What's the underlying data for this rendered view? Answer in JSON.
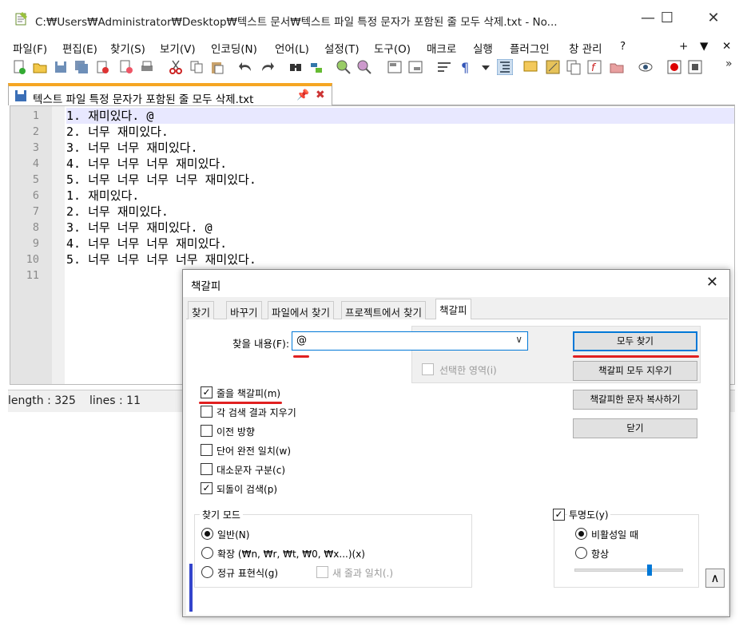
{
  "window": {
    "title": "C:₩Users₩Administrator₩Desktop₩텍스트 문서₩텍스트 파일 특정 문자가 포함된 줄 모두 삭제.txt - No...",
    "minimize": "—",
    "maximize": "☐",
    "close": "✕"
  },
  "menu": [
    "파일(F)",
    "편집(E)",
    "찾기(S)",
    "보기(V)",
    "인코딩(N)",
    "언어(L)",
    "설정(T)",
    "도구(O)",
    "매크로",
    "실행",
    "플러그인",
    "창 관리",
    "?"
  ],
  "menu_right": {
    "plus": "+",
    "down": "▼",
    "close": "✕"
  },
  "toolbar_overflow": "»",
  "tab": {
    "label": "텍스트 파일 특정 문자가 포함된 줄 모두 삭제.txt",
    "pin": "📌",
    "close": "✖"
  },
  "editor": {
    "lines": [
      {
        "n": "1",
        "text": "1. 재미있다. @"
      },
      {
        "n": "2",
        "text": "2. 너무 재미있다."
      },
      {
        "n": "3",
        "text": "3. 너무 너무 재미있다."
      },
      {
        "n": "4",
        "text": "4. 너무 너무 너무 재미있다."
      },
      {
        "n": "5",
        "text": "5. 너무 너무 너무 너무 재미있다."
      },
      {
        "n": "6",
        "text": "1. 재미있다."
      },
      {
        "n": "7",
        "text": "2. 너무 재미있다."
      },
      {
        "n": "8",
        "text": "3. 너무 너무 재미있다. @"
      },
      {
        "n": "9",
        "text": "4. 너무 너무 너무 재미있다."
      },
      {
        "n": "10",
        "text": "5. 너무 너무 너무 너무 재미있다."
      },
      {
        "n": "11",
        "text": ""
      }
    ]
  },
  "status": {
    "length": "length : 325",
    "lines": "lines : 11"
  },
  "dialog": {
    "title": "책갈피",
    "close": "✕",
    "tabs": [
      "찾기",
      "바꾸기",
      "파일에서 찾기",
      "프로젝트에서 찾기",
      "책갈피"
    ],
    "find_label": "찾을 내용(F):",
    "find_value": "@",
    "combo_arrow": "∨",
    "in_selection": "선택한 영역(i)",
    "buttons": {
      "find_all": "모두 찾기",
      "clear_all": "책갈피 모두 지우기",
      "copy_marked": "책갈피한 문자 복사하기",
      "close": "닫기"
    },
    "options": [
      {
        "label": "줄을 책갈피(m)",
        "checked": "✓"
      },
      {
        "label": "각 검색 결과 지우기",
        "checked": ""
      },
      {
        "label": "이전 방향",
        "checked": ""
      },
      {
        "label": "단어 완전 일치(w)",
        "checked": ""
      },
      {
        "label": "대소문자 구분(c)",
        "checked": ""
      },
      {
        "label": "되돌이 검색(p)",
        "checked": "✓"
      }
    ],
    "search_mode": {
      "title": "찾기 모드",
      "normal": "일반(N)",
      "extended": "확장 (₩n, ₩r, ₩t, ₩0, ₩x...)(x)",
      "regex": "정규 표현식(g)",
      "newline": "새 줄과 일치(.)",
      "selected": "normal"
    },
    "transparency": {
      "title": "투명도(y)",
      "checked": "✓",
      "on_lose_focus": "비활성일 때",
      "always": "항상",
      "selected": "on_lose_focus",
      "level": 0.7
    },
    "up_button": "∧"
  },
  "colors": {
    "accent": "#0078d7",
    "tab_top": "#f5a623",
    "annotation": "#e02020"
  }
}
